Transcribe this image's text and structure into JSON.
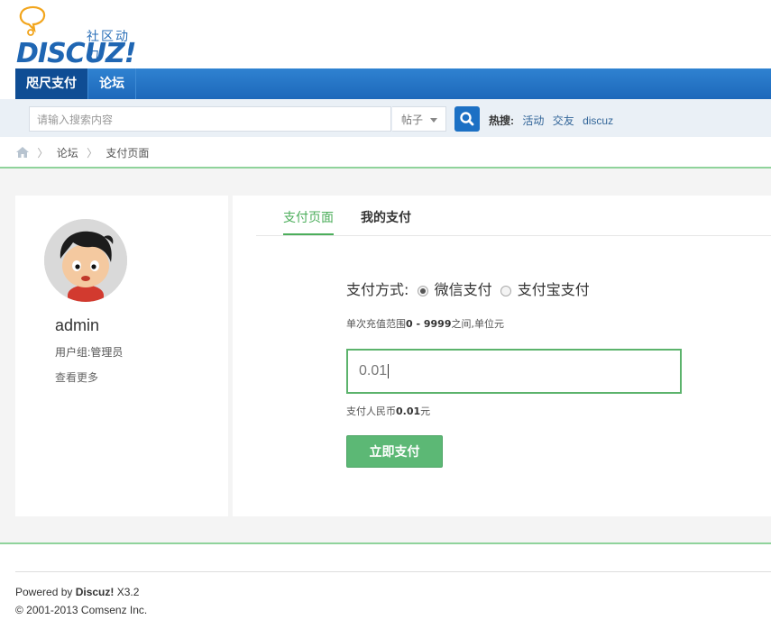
{
  "header": {
    "logo_cn": "社区动力",
    "logo_en": "DISCUZ!"
  },
  "nav": {
    "items": [
      {
        "label": "咫尺支付",
        "active": true
      },
      {
        "label": "论坛",
        "active": false
      }
    ]
  },
  "search": {
    "placeholder": "请输入搜索内容",
    "type": "帖子",
    "hot_label": "热搜:",
    "hot_terms": [
      "活动",
      "交友",
      "discuz"
    ]
  },
  "breadcrumb": {
    "home_icon": "home-icon",
    "sep": "〉",
    "items": [
      "论坛",
      "支付页面"
    ]
  },
  "user": {
    "name": "admin",
    "group": "用户组:管理员",
    "more": "查看更多"
  },
  "tabs": {
    "pay": "支付页面",
    "mine": "我的支付"
  },
  "payment": {
    "method_label": "支付方式:",
    "method_wechat": "微信支付",
    "method_alipay": "支付宝支付",
    "selected": "微信支付",
    "range_prefix": "单次充值范围",
    "range_value": "0 - 9999",
    "range_suffix": "之间,单位元",
    "amount": "0.01",
    "pay_prefix": "支付人民币",
    "pay_value": "0.01",
    "pay_suffix": "元",
    "button": "立即支付"
  },
  "footer": {
    "powered_prefix": "Powered by ",
    "powered_brand": "Discuz!",
    "powered_version": " X3.2",
    "copyright": "© 2001-2013 Comsenz Inc."
  },
  "colors": {
    "nav_blue": "#1d68ba",
    "accent_green": "#4cae5b"
  }
}
